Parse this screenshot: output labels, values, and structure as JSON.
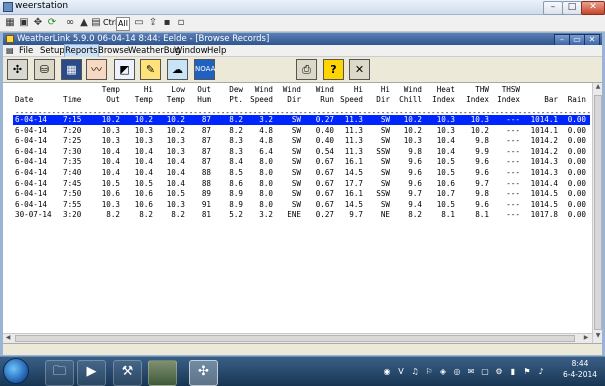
{
  "outer_window": {
    "title": "weerstation"
  },
  "outer_toolbar": {
    "ctrl_label": "Ctrl",
    "all_label": "All"
  },
  "inner_window": {
    "title": "WeatherLink 5.9.0  06-04-14  8:44: Eelde - [Browse Records]"
  },
  "menu": [
    "File",
    "Setup",
    "Reports",
    "Browse",
    "WeatherBug",
    "Window",
    "Help"
  ],
  "wl_toolbar_icons": [
    "wind-rose-icon",
    "station-icon",
    "monitor-icon",
    "strip-chart-icon",
    "graph-icon",
    "notepad-icon",
    "upload-icon",
    "noaa-icon",
    "print-icon",
    "help-icon",
    "close-icon"
  ],
  "columns_top": [
    "",
    "",
    "Temp",
    "Hi",
    "Low",
    "Out",
    "Dew",
    "Wind",
    "Wind",
    "Wind",
    "Hi",
    "Hi",
    "Wind",
    "Heat",
    "THW",
    "THSW",
    "",
    ""
  ],
  "columns_bottom": [
    "Date",
    "Time",
    "Out",
    "Temp",
    "Temp",
    "Hum",
    "Pt.",
    "Speed",
    "Dir",
    "Run",
    "Speed",
    "Dir",
    "Chill",
    "Index",
    "Index",
    "Index",
    "Bar",
    "Rain"
  ],
  "rows": [
    [
      "6-04-14",
      "7:15",
      "10.2",
      "10.2",
      "10.2",
      "87",
      "8.2",
      "3.2",
      "SW",
      "0.27",
      "11.3",
      "SW",
      "10.2",
      "10.3",
      "10.3",
      "---",
      "1014.1",
      "0.00"
    ],
    [
      "6-04-14",
      "7:20",
      "10.3",
      "10.3",
      "10.2",
      "87",
      "8.2",
      "4.8",
      "SW",
      "0.40",
      "11.3",
      "SW",
      "10.2",
      "10.3",
      "10.2",
      "---",
      "1014.1",
      "0.00"
    ],
    [
      "6-04-14",
      "7:25",
      "10.3",
      "10.3",
      "10.3",
      "87",
      "8.3",
      "4.8",
      "SW",
      "0.40",
      "11.3",
      "SW",
      "10.3",
      "10.4",
      "9.8",
      "---",
      "1014.2",
      "0.00"
    ],
    [
      "6-04-14",
      "7:30",
      "10.4",
      "10.4",
      "10.3",
      "87",
      "8.3",
      "6.4",
      "SW",
      "0.54",
      "11.3",
      "SSW",
      "9.8",
      "10.4",
      "9.9",
      "---",
      "1014.2",
      "0.00"
    ],
    [
      "6-04-14",
      "7:35",
      "10.4",
      "10.4",
      "10.4",
      "87",
      "8.4",
      "8.0",
      "SW",
      "0.67",
      "16.1",
      "SW",
      "9.6",
      "10.5",
      "9.6",
      "---",
      "1014.3",
      "0.00"
    ],
    [
      "6-04-14",
      "7:40",
      "10.4",
      "10.4",
      "10.4",
      "88",
      "8.5",
      "8.0",
      "SW",
      "0.67",
      "14.5",
      "SW",
      "9.6",
      "10.5",
      "9.6",
      "---",
      "1014.3",
      "0.00"
    ],
    [
      "6-04-14",
      "7:45",
      "10.5",
      "10.5",
      "10.4",
      "88",
      "8.6",
      "8.0",
      "SW",
      "0.67",
      "17.7",
      "SW",
      "9.6",
      "10.6",
      "9.7",
      "---",
      "1014.4",
      "0.00"
    ],
    [
      "6-04-14",
      "7:50",
      "10.6",
      "10.6",
      "10.5",
      "89",
      "8.9",
      "8.0",
      "SW",
      "0.67",
      "16.1",
      "SSW",
      "9.7",
      "10.7",
      "9.8",
      "---",
      "1014.5",
      "0.00"
    ],
    [
      "6-04-14",
      "7:55",
      "10.3",
      "10.6",
      "10.3",
      "91",
      "8.9",
      "8.0",
      "SW",
      "0.67",
      "14.5",
      "SW",
      "9.4",
      "10.5",
      "9.6",
      "---",
      "1014.5",
      "0.00"
    ],
    [
      "30-07-14",
      "3:20",
      "8.2",
      "8.2",
      "8.2",
      "81",
      "5.2",
      "3.2",
      "ENE",
      "0.27",
      "9.7",
      "NE",
      "8.2",
      "8.1",
      "8.1",
      "---",
      "1017.8",
      "0.00"
    ]
  ],
  "taskbar": {
    "apps": [
      "explorer-icon",
      "media-player-icon",
      "tools-icon",
      "weatherlink-photo-icon",
      "weatherlink-active-icon"
    ],
    "time": "8:44",
    "date": "6-4-2014"
  },
  "colors": {
    "selection": "#0026ff",
    "accent": "#2f5590"
  }
}
